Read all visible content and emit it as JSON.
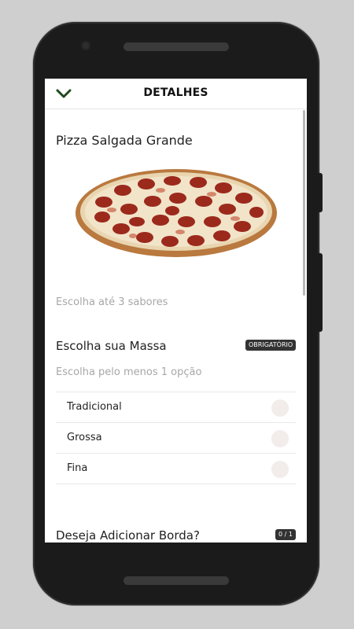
{
  "header": {
    "title": "DETALHES"
  },
  "product": {
    "name": "Pizza Salgada Grande"
  },
  "flavors_hint": "Escolha até 3 sabores",
  "massa": {
    "title": "Escolha sua Massa",
    "badge": "OBRIGATÓRIO",
    "hint": "Escolha pelo menos 1 opção",
    "options": [
      {
        "label": "Tradicional"
      },
      {
        "label": "Grossa"
      },
      {
        "label": "Fina"
      }
    ]
  },
  "borda": {
    "title": "Deseja Adicionar Borda?",
    "counter": "0 / 1"
  },
  "colors": {
    "accent": "#1f4a1f"
  }
}
